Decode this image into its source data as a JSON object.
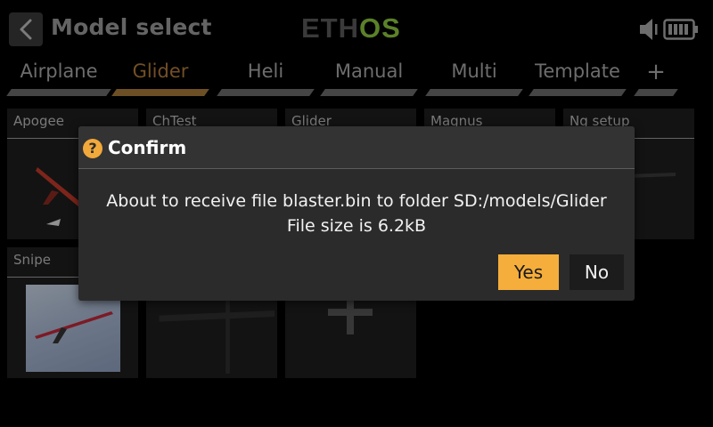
{
  "header": {
    "title": "Model select",
    "logo_main": "ETH",
    "logo_accent": "OS",
    "icons": [
      "back-arrow-icon",
      "speaker-icon",
      "battery-icon"
    ]
  },
  "tabs": [
    {
      "label": "Airplane",
      "active": false
    },
    {
      "label": "Glider",
      "active": true
    },
    {
      "label": "Heli",
      "active": false
    },
    {
      "label": "Manual",
      "active": false
    },
    {
      "label": "Multi",
      "active": false
    },
    {
      "label": "Template",
      "active": false
    },
    {
      "label": "+",
      "active": false
    }
  ],
  "models": [
    {
      "name": "Apogee",
      "image": "red-glider"
    },
    {
      "name": "ChTest",
      "image": "none"
    },
    {
      "name": "Glider",
      "image": "none"
    },
    {
      "name": "Magnus",
      "image": "none"
    },
    {
      "name": "Ng setup",
      "image": "glider-silhouette"
    },
    {
      "name": "Snipe",
      "image": "glider-photo"
    },
    {
      "name": "",
      "image": "glider-silhouette"
    },
    {
      "name": "",
      "image": "add-model"
    }
  ],
  "dialog": {
    "title": "Confirm",
    "icon": "question-icon",
    "message_line1": "About to receive file blaster.bin to folder SD:/models/Glider",
    "message_line2": "File size is 6.2kB",
    "yes_label": "Yes",
    "no_label": "No"
  },
  "colors": {
    "accent": "#f5ae3b",
    "active_tab": "#a87a3a",
    "logo_accent": "#8cc63f",
    "dialog_bg": "#2b2b2b"
  }
}
